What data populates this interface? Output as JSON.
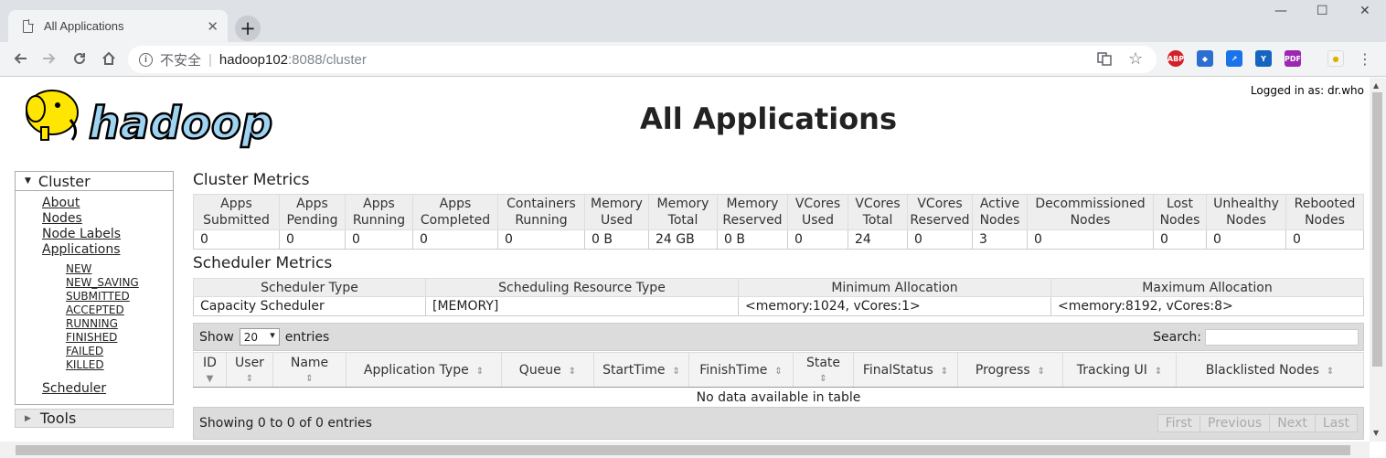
{
  "browser": {
    "tab_title": "All Applications",
    "insecure_label": "不安全",
    "url_host": "hadoop102",
    "url_path": ":8088/cluster",
    "extensions": [
      {
        "name": "abp",
        "label": "ABP",
        "color": "#d42129"
      },
      {
        "name": "ext-blue-1",
        "label": "",
        "color": "#2a6fd1"
      },
      {
        "name": "ext-blue-2",
        "label": "",
        "color": "#1a73e8"
      },
      {
        "name": "ext-vue",
        "label": "",
        "color": "#1565c0"
      },
      {
        "name": "ext-pdf",
        "label": "",
        "color": "#9c27b0"
      }
    ]
  },
  "header": {
    "logo_text": "hadoop",
    "logged_in": "Logged in as: dr.who",
    "title": "All Applications"
  },
  "sidebar": {
    "cluster_label": "Cluster",
    "links": [
      "About",
      "Nodes",
      "Node Labels",
      "Applications"
    ],
    "app_states": [
      "NEW",
      "NEW_SAVING",
      "SUBMITTED",
      "ACCEPTED",
      "RUNNING",
      "FINISHED",
      "FAILED",
      "KILLED"
    ],
    "scheduler": "Scheduler",
    "tools_label": "Tools"
  },
  "cluster_metrics": {
    "title": "Cluster Metrics",
    "headers": [
      [
        "Apps",
        "Submitted"
      ],
      [
        "Apps",
        "Pending"
      ],
      [
        "Apps",
        "Running"
      ],
      [
        "Apps",
        "Completed"
      ],
      [
        "Containers",
        "Running"
      ],
      [
        "Memory",
        "Used"
      ],
      [
        "Memory",
        "Total"
      ],
      [
        "Memory",
        "Reserved"
      ],
      [
        "VCores",
        "Used"
      ],
      [
        "VCores",
        "Total"
      ],
      [
        "VCores",
        "Reserved"
      ],
      [
        "Active",
        "Nodes"
      ],
      [
        "Decommissioned",
        "Nodes"
      ],
      [
        "Lost",
        "Nodes"
      ],
      [
        "Unhealthy",
        "Nodes"
      ],
      [
        "Rebooted",
        "Nodes"
      ]
    ],
    "values": [
      "0",
      "0",
      "0",
      "0",
      "0",
      "0 B",
      "24 GB",
      "0 B",
      "0",
      "24",
      "0",
      "3",
      "0",
      "0",
      "0",
      "0"
    ]
  },
  "scheduler_metrics": {
    "title": "Scheduler Metrics",
    "headers": [
      "Scheduler Type",
      "Scheduling Resource Type",
      "Minimum Allocation",
      "Maximum Allocation"
    ],
    "values": [
      "Capacity Scheduler",
      "[MEMORY]",
      "<memory:1024, vCores:1>",
      "<memory:8192, vCores:8>"
    ]
  },
  "apps_table": {
    "show_label": "Show",
    "page_size": "20",
    "entries_label": "entries",
    "search_label": "Search:",
    "columns": [
      "ID",
      "User",
      "Name",
      "Application Type",
      "Queue",
      "StartTime",
      "FinishTime",
      "State",
      "FinalStatus",
      "Progress",
      "Tracking UI",
      "Blacklisted Nodes"
    ],
    "empty_message": "No data available in table",
    "info": "Showing 0 to 0 of 0 entries",
    "pager": [
      "First",
      "Previous",
      "Next",
      "Last"
    ]
  }
}
